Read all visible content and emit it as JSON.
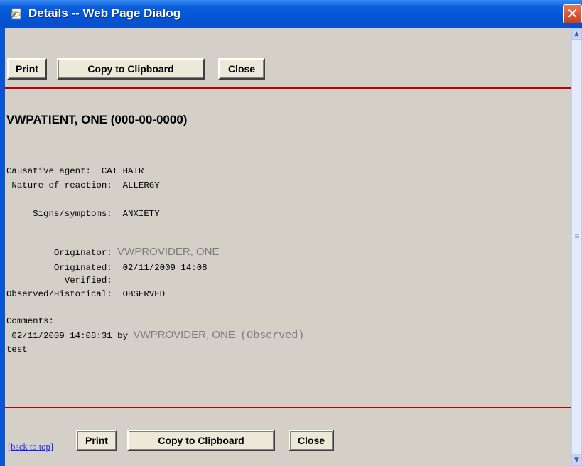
{
  "window": {
    "title": "Details -- Web Page Dialog",
    "close_glyph": "✕"
  },
  "toolbar_top": {
    "print_label": "Print",
    "copy_label": "Copy to Clipboard",
    "close_label": "Close"
  },
  "toolbar_bottom": {
    "back_to_top_label": "[back to top]",
    "print_label": "Print",
    "copy_label": "Copy to Clipboard",
    "close_label": "Close"
  },
  "patient": {
    "header": "VWPATIENT, ONE (000-00-0000)"
  },
  "details": {
    "causative_agent_label": "Causative agent:",
    "causative_agent_value": "CAT HAIR",
    "nature_label": " Nature of reaction:",
    "nature_value": "ALLERGY",
    "signs_label": "     Signs/symptoms:",
    "signs_value": "ANXIETY",
    "originator_label": "         Originator:",
    "originator_value": "VWPROVIDER, ONE",
    "originated_label": "         Originated:",
    "originated_value": "02/11/2009 14:08",
    "verified_label": "           Verified:",
    "observed_label": "Observed/Historical:",
    "observed_value": "OBSERVED"
  },
  "comments": {
    "label": "Comments:",
    "entry_prefix": " 02/11/2009 14:08:31 by ",
    "entry_author": "VWPROVIDER, ONE",
    "entry_type": "(Observed)",
    "text": "test"
  },
  "colors": {
    "rule": "#b80000",
    "title_bar": "#0454d6",
    "link": "#1a1aff"
  },
  "icons": {
    "title": "ie-page-icon",
    "scroll_up": "▲",
    "scroll_down": "▼"
  }
}
